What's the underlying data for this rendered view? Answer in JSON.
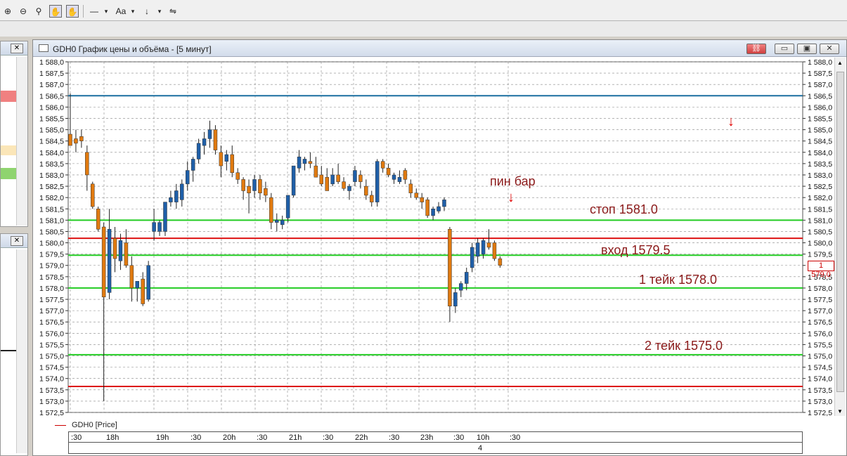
{
  "toolbar": {
    "buttons": [
      "⊕",
      "⊖",
      "⚲",
      "✋",
      "✋",
      "—",
      "▾",
      "Aa",
      "▾",
      "↓",
      "▾",
      "⇋"
    ]
  },
  "window": {
    "title": "GDH0 График цены и объёма - [5 минут]",
    "controls": [
      "link",
      "minimize",
      "restore",
      "close"
    ]
  },
  "legend": {
    "series_name": "GDH0 [Price]"
  },
  "current_price_label": "1 579,0",
  "annotations": {
    "pin_bar": "пин бар",
    "stop": "стоп 1581.0",
    "entry": "вход 1579.5",
    "take1": "1 тейк 1578.0",
    "take2": "2 тейк 1575.0",
    "arrow": "↓"
  },
  "x_axis": {
    "row1": [
      ":30",
      "18h",
      "19h",
      ":30",
      "20h",
      ":30",
      "21h",
      ":30",
      "22h",
      ":30",
      "23h",
      ":30",
      "10h",
      ":30"
    ],
    "row2": [
      "4"
    ]
  },
  "chart_data": {
    "type": "candlestick",
    "symbol": "GDH0",
    "timeframe": "5 минут",
    "ylim": [
      1572.5,
      1588.0
    ],
    "y_step": 0.5,
    "y_tick_labels": [
      "1 588,0",
      "1 587,5",
      "1 587,0",
      "1 586,5",
      "1 586,0",
      "1 585,5",
      "1 585,0",
      "1 584,5",
      "1 584,0",
      "1 583,5",
      "1 583,0",
      "1 582,5",
      "1 582,0",
      "1 581,5",
      "1 581,0",
      "1 580,5",
      "1 580,0",
      "1 579,5",
      "1 579,0",
      "1 578,5",
      "1 578,0",
      "1 577,5",
      "1 577,0",
      "1 576,5",
      "1 576,0",
      "1 575,5",
      "1 575,0",
      "1 574,5",
      "1 574,0",
      "1 573,5",
      "1 573,0",
      "1 572,5"
    ],
    "grid": true,
    "colors": {
      "up": "#1f5fa8",
      "down": "#e07a10",
      "wick": "#222222",
      "grid": "#888888"
    },
    "horizontal_lines": [
      {
        "price": 1586.5,
        "color": "#1a6fa0"
      },
      {
        "price": 1581.0,
        "color": "#22cc22"
      },
      {
        "price": 1580.2,
        "color": "#dd1111"
      },
      {
        "price": 1579.45,
        "color": "#22cc22"
      },
      {
        "price": 1578.0,
        "color": "#22cc22"
      },
      {
        "price": 1575.05,
        "color": "#22cc22"
      },
      {
        "price": 1573.65,
        "color": "#dd1111"
      }
    ],
    "candles": [
      {
        "o": 1584.8,
        "h": 1586.6,
        "l": 1584.3,
        "c": 1584.3
      },
      {
        "o": 1584.6,
        "h": 1585.0,
        "l": 1584.0,
        "c": 1584.4
      },
      {
        "o": 1584.7,
        "h": 1585.0,
        "l": 1584.2,
        "c": 1584.5
      },
      {
        "o": 1584.0,
        "h": 1584.3,
        "l": 1582.3,
        "c": 1583.0
      },
      {
        "o": 1582.6,
        "h": 1582.7,
        "l": 1581.5,
        "c": 1581.6
      },
      {
        "o": 1581.5,
        "h": 1581.6,
        "l": 1580.5,
        "c": 1580.6
      },
      {
        "o": 1580.7,
        "h": 1580.9,
        "l": 1573.0,
        "c": 1577.6
      },
      {
        "o": 1577.8,
        "h": 1581.5,
        "l": 1577.5,
        "c": 1580.6
      },
      {
        "o": 1580.2,
        "h": 1580.7,
        "l": 1578.7,
        "c": 1579.3
      },
      {
        "o": 1579.2,
        "h": 1580.4,
        "l": 1578.8,
        "c": 1580.1
      },
      {
        "o": 1580.0,
        "h": 1580.6,
        "l": 1578.9,
        "c": 1579.0
      },
      {
        "o": 1579.0,
        "h": 1579.4,
        "l": 1577.4,
        "c": 1578.0
      },
      {
        "o": 1578.0,
        "h": 1578.3,
        "l": 1577.4,
        "c": 1578.3
      },
      {
        "o": 1578.4,
        "h": 1578.7,
        "l": 1577.2,
        "c": 1577.3
      },
      {
        "o": 1577.5,
        "h": 1579.2,
        "l": 1577.4,
        "c": 1579.0
      },
      {
        "o": 1580.5,
        "h": 1581.5,
        "l": 1580.1,
        "c": 1580.9
      },
      {
        "o": 1580.5,
        "h": 1581.0,
        "l": 1580.3,
        "c": 1580.9
      },
      {
        "o": 1580.5,
        "h": 1581.8,
        "l": 1580.3,
        "c": 1581.8
      },
      {
        "o": 1581.8,
        "h": 1582.3,
        "l": 1581.6,
        "c": 1582.0
      },
      {
        "o": 1581.8,
        "h": 1582.6,
        "l": 1581.5,
        "c": 1582.3
      },
      {
        "o": 1581.9,
        "h": 1582.8,
        "l": 1581.6,
        "c": 1582.6
      },
      {
        "o": 1582.6,
        "h": 1583.6,
        "l": 1582.3,
        "c": 1583.2
      },
      {
        "o": 1583.2,
        "h": 1583.8,
        "l": 1582.7,
        "c": 1583.7
      },
      {
        "o": 1583.7,
        "h": 1584.6,
        "l": 1583.5,
        "c": 1584.4
      },
      {
        "o": 1584.3,
        "h": 1584.9,
        "l": 1583.9,
        "c": 1584.6
      },
      {
        "o": 1584.6,
        "h": 1585.4,
        "l": 1584.2,
        "c": 1585.0
      },
      {
        "o": 1585.0,
        "h": 1585.2,
        "l": 1583.9,
        "c": 1584.1
      },
      {
        "o": 1584.0,
        "h": 1584.3,
        "l": 1582.9,
        "c": 1583.4
      },
      {
        "o": 1583.6,
        "h": 1584.1,
        "l": 1583.2,
        "c": 1583.9
      },
      {
        "o": 1583.9,
        "h": 1584.3,
        "l": 1582.9,
        "c": 1583.1
      },
      {
        "o": 1583.1,
        "h": 1583.3,
        "l": 1582.6,
        "c": 1582.8
      },
      {
        "o": 1582.8,
        "h": 1582.9,
        "l": 1581.9,
        "c": 1582.3
      },
      {
        "o": 1582.5,
        "h": 1582.8,
        "l": 1581.3,
        "c": 1582.2
      },
      {
        "o": 1582.3,
        "h": 1583.0,
        "l": 1582.0,
        "c": 1582.8
      },
      {
        "o": 1582.8,
        "h": 1583.0,
        "l": 1581.9,
        "c": 1582.2
      },
      {
        "o": 1582.4,
        "h": 1582.7,
        "l": 1581.8,
        "c": 1582.1
      },
      {
        "o": 1582.0,
        "h": 1582.2,
        "l": 1580.6,
        "c": 1580.9
      },
      {
        "o": 1580.9,
        "h": 1581.3,
        "l": 1580.5,
        "c": 1581.0
      },
      {
        "o": 1580.8,
        "h": 1581.2,
        "l": 1580.6,
        "c": 1581.0
      },
      {
        "o": 1581.1,
        "h": 1582.1,
        "l": 1580.9,
        "c": 1582.1
      },
      {
        "o": 1582.1,
        "h": 1583.4,
        "l": 1582.0,
        "c": 1583.4
      },
      {
        "o": 1583.3,
        "h": 1584.1,
        "l": 1583.1,
        "c": 1583.8
      },
      {
        "o": 1583.5,
        "h": 1583.8,
        "l": 1583.2,
        "c": 1583.7
      },
      {
        "o": 1583.6,
        "h": 1584.0,
        "l": 1583.3,
        "c": 1583.5
      },
      {
        "o": 1583.4,
        "h": 1583.8,
        "l": 1582.9,
        "c": 1582.9
      },
      {
        "o": 1583.0,
        "h": 1583.4,
        "l": 1582.5,
        "c": 1582.6
      },
      {
        "o": 1582.9,
        "h": 1583.3,
        "l": 1582.3,
        "c": 1582.3
      },
      {
        "o": 1582.6,
        "h": 1583.3,
        "l": 1582.5,
        "c": 1583.0
      },
      {
        "o": 1583.0,
        "h": 1583.5,
        "l": 1582.6,
        "c": 1582.7
      },
      {
        "o": 1582.7,
        "h": 1582.9,
        "l": 1582.3,
        "c": 1582.4
      },
      {
        "o": 1582.3,
        "h": 1582.6,
        "l": 1581.9,
        "c": 1582.5
      },
      {
        "o": 1582.7,
        "h": 1583.4,
        "l": 1582.5,
        "c": 1583.2
      },
      {
        "o": 1583.0,
        "h": 1583.2,
        "l": 1582.4,
        "c": 1582.7
      },
      {
        "o": 1582.5,
        "h": 1582.8,
        "l": 1581.9,
        "c": 1582.1
      },
      {
        "o": 1582.1,
        "h": 1582.3,
        "l": 1581.6,
        "c": 1581.8
      },
      {
        "o": 1581.8,
        "h": 1583.7,
        "l": 1581.6,
        "c": 1583.6
      },
      {
        "o": 1583.6,
        "h": 1583.7,
        "l": 1583.1,
        "c": 1583.3
      },
      {
        "o": 1583.3,
        "h": 1583.5,
        "l": 1582.9,
        "c": 1583.0
      },
      {
        "o": 1582.8,
        "h": 1583.1,
        "l": 1582.6,
        "c": 1583.0
      },
      {
        "o": 1582.7,
        "h": 1583.2,
        "l": 1582.6,
        "c": 1582.9
      },
      {
        "o": 1583.2,
        "h": 1583.3,
        "l": 1582.6,
        "c": 1582.8
      },
      {
        "o": 1582.6,
        "h": 1582.8,
        "l": 1582.0,
        "c": 1582.2
      },
      {
        "o": 1582.2,
        "h": 1582.4,
        "l": 1581.9,
        "c": 1582.0
      },
      {
        "o": 1582.0,
        "h": 1582.2,
        "l": 1581.5,
        "c": 1581.8
      },
      {
        "o": 1581.9,
        "h": 1582.0,
        "l": 1581.1,
        "c": 1581.2
      },
      {
        "o": 1581.2,
        "h": 1581.6,
        "l": 1581.0,
        "c": 1581.5
      },
      {
        "o": 1581.4,
        "h": 1581.8,
        "l": 1581.3,
        "c": 1581.6
      },
      {
        "o": 1581.6,
        "h": 1582.0,
        "l": 1581.4,
        "c": 1581.9
      },
      {
        "o": 1580.6,
        "h": 1580.7,
        "l": 1576.5,
        "c": 1577.2
      },
      {
        "o": 1577.2,
        "h": 1578.0,
        "l": 1576.9,
        "c": 1577.8
      },
      {
        "o": 1577.9,
        "h": 1578.3,
        "l": 1577.6,
        "c": 1578.2
      },
      {
        "o": 1578.2,
        "h": 1578.9,
        "l": 1577.9,
        "c": 1578.7
      },
      {
        "o": 1578.9,
        "h": 1580.0,
        "l": 1578.7,
        "c": 1579.8
      },
      {
        "o": 1579.4,
        "h": 1580.2,
        "l": 1579.1,
        "c": 1580.0
      },
      {
        "o": 1579.5,
        "h": 1580.2,
        "l": 1579.3,
        "c": 1580.1
      },
      {
        "o": 1580.0,
        "h": 1580.6,
        "l": 1579.7,
        "c": 1579.8
      },
      {
        "o": 1580.0,
        "h": 1580.1,
        "l": 1579.2,
        "c": 1579.3
      },
      {
        "o": 1579.3,
        "h": 1579.4,
        "l": 1578.9,
        "c": 1579.0
      }
    ]
  }
}
